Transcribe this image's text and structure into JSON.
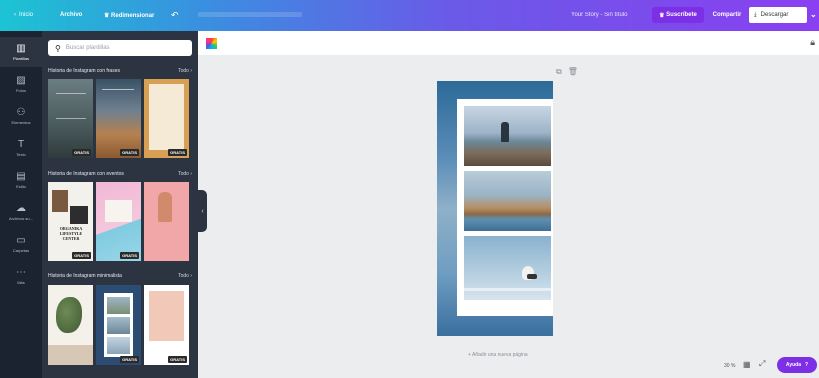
{
  "topbar": {
    "back_label": "Inicio",
    "archivo_label": "Archivo",
    "resize_label": "Redimensionar",
    "design_name": "Your Story - Sin título",
    "subscribe_label": "Suscríbete",
    "share_label": "Compartir",
    "download_label": "Descargar"
  },
  "rail": [
    {
      "label": "Plantillas",
      "icon": "▥"
    },
    {
      "label": "Fotos",
      "icon": "▨"
    },
    {
      "label": "Elementos",
      "icon": "⚇"
    },
    {
      "label": "Texto",
      "icon": "T"
    },
    {
      "label": "Estilo",
      "icon": "▤"
    },
    {
      "label": "Archivos su...",
      "icon": "☁"
    },
    {
      "label": "Carpetas",
      "icon": "▭"
    },
    {
      "label": "Más",
      "icon": "⋯"
    }
  ],
  "panel": {
    "search_placeholder": "Buscar plantillas",
    "sections": [
      {
        "title": "Historia de Instagram con frases",
        "all": "Todo"
      },
      {
        "title": "Historia de Instagram con eventos",
        "all": "Todo"
      },
      {
        "title": "Historia de Instagram minimalista",
        "all": "Todo"
      }
    ],
    "badge": "GRATIS",
    "template_texts": {
      "organica_title": "ORGANIKA\nLIFESTYLE\nCENTER"
    }
  },
  "canvas": {
    "add_page_label": "+ Añadir una nueva página",
    "zoom": "30 %",
    "help_label": "Ayuda",
    "help_q": "?"
  },
  "colors": {
    "brand_purple": "#7c2fe5",
    "sidebar_dark": "#1b2230",
    "panel_dark": "#2c3442"
  }
}
